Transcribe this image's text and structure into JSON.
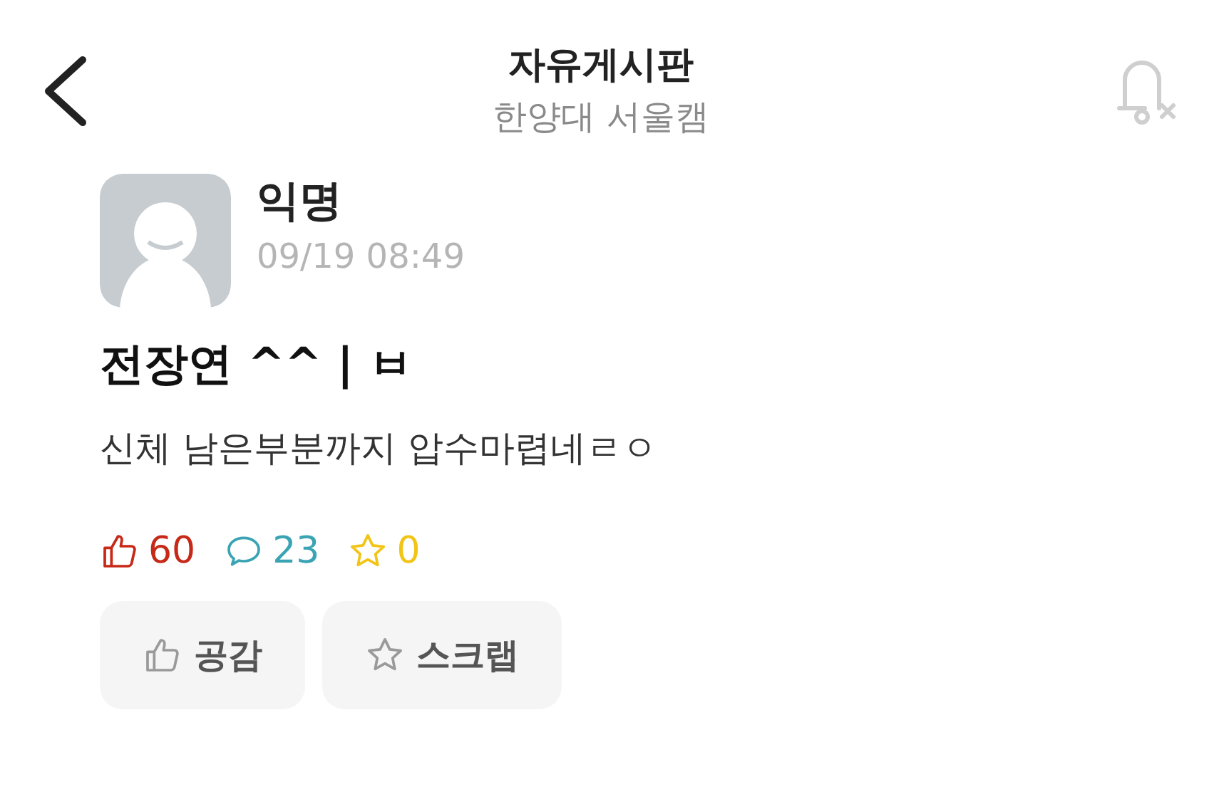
{
  "header": {
    "title": "자유게시판",
    "subtitle": "한양대 서울캠"
  },
  "post": {
    "author": "익명",
    "time": "09/19 08:49",
    "title": "전장연 ^^ | ㅂ",
    "body": "신체 남은부분까지 압수마렵네ㄹㅇ"
  },
  "stats": [
    {
      "kind": "like",
      "count": "60",
      "color": "#c62917"
    },
    {
      "kind": "comment",
      "count": "23",
      "color": "#3aa4b4"
    },
    {
      "kind": "scrap",
      "count": "0",
      "color": "#f2c416"
    }
  ],
  "buttons": [
    {
      "kind": "like",
      "label": "공감"
    },
    {
      "kind": "scrap",
      "label": "스크랩"
    }
  ]
}
